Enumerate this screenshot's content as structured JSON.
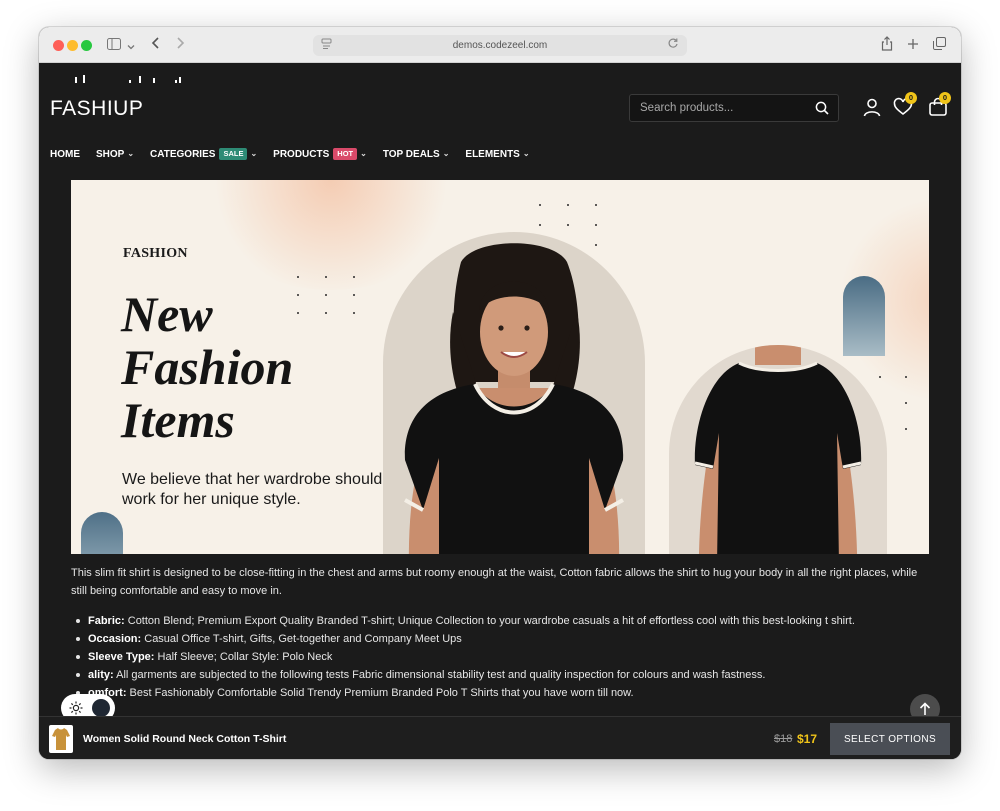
{
  "browser": {
    "url": "demos.codezeel.com",
    "icons": [
      "sidebar-icon",
      "chevron-down-icon",
      "back-icon",
      "forward-icon",
      "reload-icon",
      "share-icon",
      "new-tab-icon",
      "tabs-icon"
    ]
  },
  "header": {
    "logo": "FASHIUP",
    "search_placeholder": "Search products...",
    "wishlist_count": "0",
    "cart_count": "0"
  },
  "nav": {
    "items": [
      {
        "label": "HOME"
      },
      {
        "label": "SHOP"
      },
      {
        "label": "CATEGORIES",
        "tag": "SALE"
      },
      {
        "label": "PRODUCTS",
        "tag": "HOT"
      },
      {
        "label": "TOP DEALS"
      },
      {
        "label": "ELEMENTS"
      }
    ]
  },
  "banner": {
    "kicker": "FASHION",
    "title_line1": "New",
    "title_line2": "Fashion",
    "title_line3": "Items",
    "subtitle": "We believe that her wardrobe should work for her unique style."
  },
  "description": {
    "intro": "This slim fit shirt is designed to be close-fitting in the chest and arms but roomy enough at the waist, Cotton fabric allows the shirt to hug your body in all the right places, while still being comfortable and easy to move in.",
    "bullets": [
      {
        "label": "Fabric:",
        "text": " Cotton Blend; Premium Export Quality Branded T-shirt; Unique Collection to your wardrobe casuals a hit of effortless cool with this best-looking t shirt."
      },
      {
        "label": "Occasion:",
        "text": " Casual Office T-shirt, Gifts, Get-together and Company Meet Ups"
      },
      {
        "label": "Sleeve Type:",
        "text": " Half Sleeve; Collar Style: Polo Neck"
      },
      {
        "label": "ality:",
        "text": " All garments are subjected to the following tests Fabric dimensional stability test and quality inspection for colours and wash fastness."
      },
      {
        "label": "omfort:",
        "text": " Best Fashionably Comfortable Solid Trendy Premium Branded Polo T Shirts that you have worn till now."
      }
    ]
  },
  "sticky": {
    "product_name": "Women Solid Round Neck Cotton T-Shirt",
    "old_price": "$18",
    "new_price": "$17",
    "button": "SELECT OPTIONS"
  },
  "colors": {
    "background": "#1b1b1b",
    "accent_yellow": "#f0c419",
    "sale_tag": "#2e8b75",
    "hot_tag": "#d94a6a",
    "banner_bg": "#f7f1e8"
  }
}
